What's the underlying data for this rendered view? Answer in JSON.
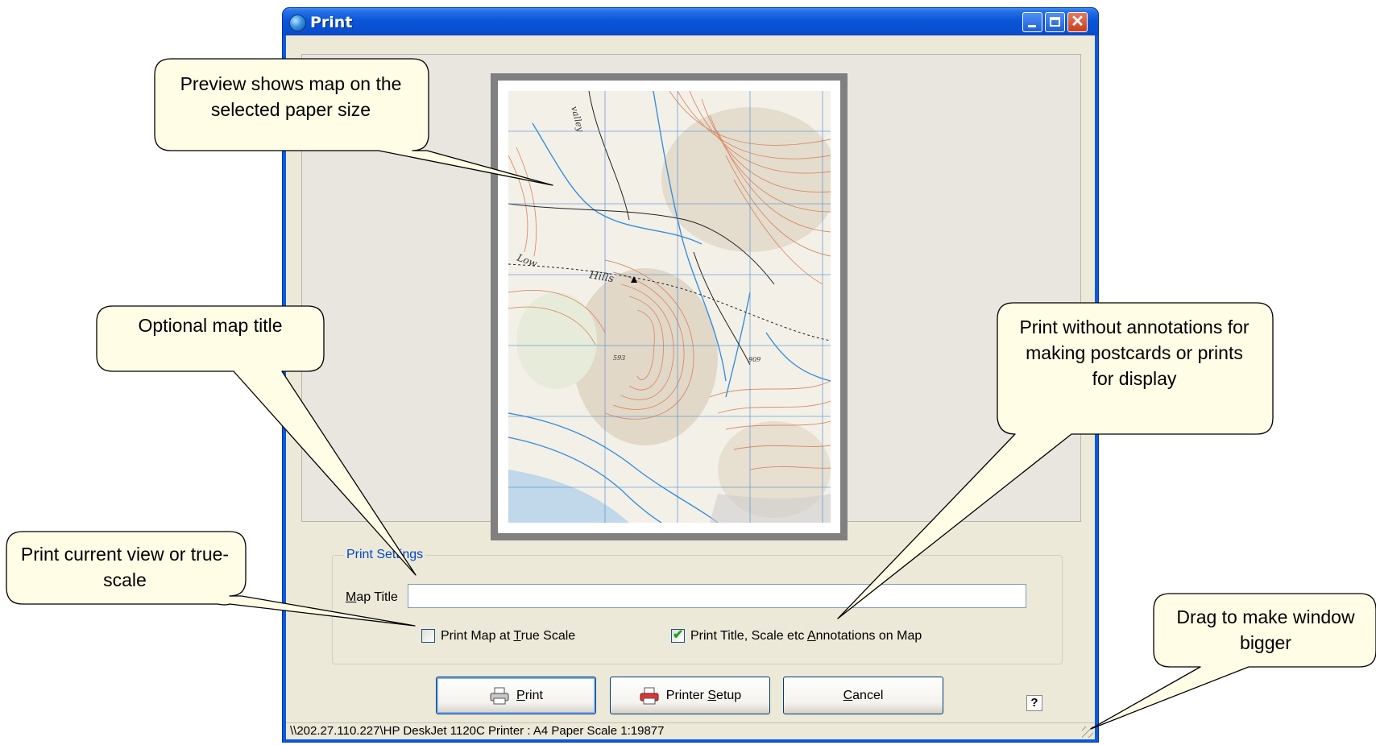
{
  "window": {
    "title": "Print"
  },
  "preview": {
    "map_labels": [
      "valley",
      "Low",
      "Hills",
      "593",
      "909"
    ]
  },
  "settings": {
    "group_label": "Print Settings",
    "map_title_label_prefix": "",
    "map_title_label_accel": "M",
    "map_title_label_rest": "ap Title",
    "map_title_value": "",
    "true_scale_checkbox": {
      "checked": false,
      "label_before": "Print Map at ",
      "accel": "T",
      "label_after": "rue Scale"
    },
    "annotations_checkbox": {
      "checked": true,
      "label_before": "Print Title, Scale etc ",
      "accel": "A",
      "label_after": "nnotations on Map"
    }
  },
  "buttons": {
    "print": {
      "accel": "P",
      "rest": "rint"
    },
    "printer_setup": {
      "before": "Printer ",
      "accel": "S",
      "rest": "etup"
    },
    "cancel": {
      "accel": "C",
      "rest": "ancel"
    },
    "help": "?"
  },
  "statusbar": {
    "text": "\\\\202.27.110.227\\HP DeskJet 1120C Printer : A4 Paper  Scale 1:19877"
  },
  "callouts": {
    "preview": "Preview shows map on the selected paper size",
    "map_title": "Optional map title",
    "true_scale": "Print current view or true-scale",
    "annotations": "Print without annotations for making postcards or prints for display",
    "resize": "Drag to make window bigger"
  },
  "colors": {
    "titlebar": "#0a56d8",
    "window_face": "#ece9d8",
    "groupbox_label": "#0046d5",
    "callout_fill": "#fffde6",
    "contour": "#d9825a",
    "water": "#3b8fd9"
  }
}
